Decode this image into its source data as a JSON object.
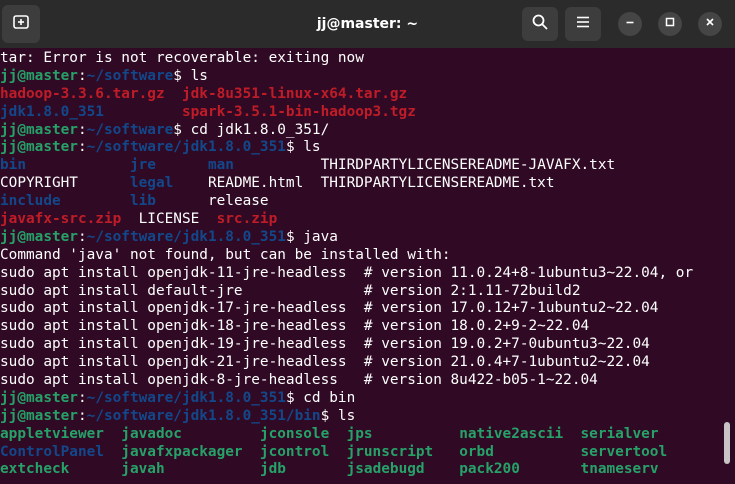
{
  "window": {
    "title": "jj@master: ~"
  },
  "icons": {
    "new_tab": "new-tab-icon",
    "search": "search-icon",
    "menu": "hamburger-menu-icon",
    "minimize": "minimize-icon",
    "maximize": "maximize-icon",
    "close": "close-icon"
  },
  "colors": {
    "background": "#300a24",
    "titlebar": "#2b2b2b",
    "prompt_user": "#26a269",
    "prompt_path": "#12488b",
    "archive": "#c01c28",
    "executable": "#26a269",
    "directory": "#12488b"
  },
  "terminal": {
    "lines": [
      [
        {
          "t": "tar: Error is not recoverable: exiting now",
          "c": "w"
        }
      ],
      [
        {
          "t": "jj@master",
          "c": "g"
        },
        {
          "t": ":",
          "c": "w"
        },
        {
          "t": "~/software",
          "c": "b"
        },
        {
          "t": "$ ls",
          "c": "w"
        }
      ],
      [
        {
          "t": "hadoop-3.3.6.tar.gz",
          "c": "r"
        },
        {
          "t": "  ",
          "c": "w"
        },
        {
          "t": "jdk-8u351-linux-x64.tar.gz",
          "c": "r"
        }
      ],
      [
        {
          "t": "jdk1.8.0_351",
          "c": "bl"
        },
        {
          "t": "         ",
          "c": "w"
        },
        {
          "t": "spark-3.5.1-bin-hadoop3.tgz",
          "c": "r"
        }
      ],
      [
        {
          "t": "jj@master",
          "c": "g"
        },
        {
          "t": ":",
          "c": "w"
        },
        {
          "t": "~/software",
          "c": "b"
        },
        {
          "t": "$ cd jdk1.8.0_351/",
          "c": "w"
        }
      ],
      [
        {
          "t": "jj@master",
          "c": "g"
        },
        {
          "t": ":",
          "c": "w"
        },
        {
          "t": "~/software/jdk1.8.0_351",
          "c": "b"
        },
        {
          "t": "$ ls",
          "c": "w"
        }
      ],
      [
        {
          "t": "bin",
          "c": "bl"
        },
        {
          "t": "            ",
          "c": "w"
        },
        {
          "t": "jre",
          "c": "bl"
        },
        {
          "t": "      ",
          "c": "w"
        },
        {
          "t": "man",
          "c": "bl"
        },
        {
          "t": "          THIRDPARTYLICENSEREADME-JAVAFX.txt",
          "c": "w"
        }
      ],
      [
        {
          "t": "COPYRIGHT      ",
          "c": "w"
        },
        {
          "t": "legal",
          "c": "bl"
        },
        {
          "t": "    README.html  THIRDPARTYLICENSEREADME.txt",
          "c": "w"
        }
      ],
      [
        {
          "t": "include",
          "c": "bl"
        },
        {
          "t": "        ",
          "c": "w"
        },
        {
          "t": "lib",
          "c": "bl"
        },
        {
          "t": "      release",
          "c": "w"
        }
      ],
      [
        {
          "t": "javafx-src.zip",
          "c": "r"
        },
        {
          "t": "  LICENSE  ",
          "c": "w"
        },
        {
          "t": "src.zip",
          "c": "r"
        }
      ],
      [
        {
          "t": "jj@master",
          "c": "g"
        },
        {
          "t": ":",
          "c": "w"
        },
        {
          "t": "~/software/jdk1.8.0_351",
          "c": "b"
        },
        {
          "t": "$ java",
          "c": "w"
        }
      ],
      [
        {
          "t": "Command 'java' not found, but can be installed with:",
          "c": "w"
        }
      ],
      [
        {
          "t": "sudo apt install openjdk-11-jre-headless  # version 11.0.24+8-1ubuntu3~22.04, or",
          "c": "w"
        }
      ],
      [
        {
          "t": "sudo apt install default-jre              # version 2:1.11-72build2",
          "c": "w"
        }
      ],
      [
        {
          "t": "sudo apt install openjdk-17-jre-headless  # version 17.0.12+7-1ubuntu2~22.04",
          "c": "w"
        }
      ],
      [
        {
          "t": "sudo apt install openjdk-18-jre-headless  # version 18.0.2+9-2~22.04",
          "c": "w"
        }
      ],
      [
        {
          "t": "sudo apt install openjdk-19-jre-headless  # version 19.0.2+7-0ubuntu3~22.04",
          "c": "w"
        }
      ],
      [
        {
          "t": "sudo apt install openjdk-21-jre-headless  # version 21.0.4+7-1ubuntu2~22.04",
          "c": "w"
        }
      ],
      [
        {
          "t": "sudo apt install openjdk-8-jre-headless   # version 8u422-b05-1~22.04",
          "c": "w"
        }
      ],
      [
        {
          "t": "jj@master",
          "c": "g"
        },
        {
          "t": ":",
          "c": "w"
        },
        {
          "t": "~/software/jdk1.8.0_351",
          "c": "b"
        },
        {
          "t": "$ cd bin",
          "c": "w"
        }
      ],
      [
        {
          "t": "jj@master",
          "c": "g"
        },
        {
          "t": ":",
          "c": "w"
        },
        {
          "t": "~/software/jdk1.8.0_351/bin",
          "c": "b"
        },
        {
          "t": "$ ls",
          "c": "w"
        }
      ],
      [
        {
          "t": "appletviewer",
          "c": "gr"
        },
        {
          "t": "  ",
          "c": "w"
        },
        {
          "t": "javadoc",
          "c": "gr"
        },
        {
          "t": "         ",
          "c": "w"
        },
        {
          "t": "jconsole",
          "c": "gr"
        },
        {
          "t": "  ",
          "c": "w"
        },
        {
          "t": "jps",
          "c": "gr"
        },
        {
          "t": "          ",
          "c": "w"
        },
        {
          "t": "native2ascii",
          "c": "gr"
        },
        {
          "t": "  ",
          "c": "w"
        },
        {
          "t": "serialver",
          "c": "gr"
        }
      ],
      [
        {
          "t": "ControlPanel",
          "c": "bl"
        },
        {
          "t": "  ",
          "c": "w"
        },
        {
          "t": "javafxpackager",
          "c": "gr"
        },
        {
          "t": "  ",
          "c": "w"
        },
        {
          "t": "jcontrol",
          "c": "gr"
        },
        {
          "t": "  ",
          "c": "w"
        },
        {
          "t": "jrunscript",
          "c": "gr"
        },
        {
          "t": "   ",
          "c": "w"
        },
        {
          "t": "orbd",
          "c": "gr"
        },
        {
          "t": "          ",
          "c": "w"
        },
        {
          "t": "servertool",
          "c": "gr"
        }
      ],
      [
        {
          "t": "extcheck",
          "c": "gr"
        },
        {
          "t": "      ",
          "c": "w"
        },
        {
          "t": "javah",
          "c": "gr"
        },
        {
          "t": "           ",
          "c": "w"
        },
        {
          "t": "jdb",
          "c": "gr"
        },
        {
          "t": "       ",
          "c": "w"
        },
        {
          "t": "jsadebugd",
          "c": "gr"
        },
        {
          "t": "    ",
          "c": "w"
        },
        {
          "t": "pack200",
          "c": "gr"
        },
        {
          "t": "       ",
          "c": "w"
        },
        {
          "t": "tnameserv",
          "c": "gr"
        }
      ]
    ]
  }
}
